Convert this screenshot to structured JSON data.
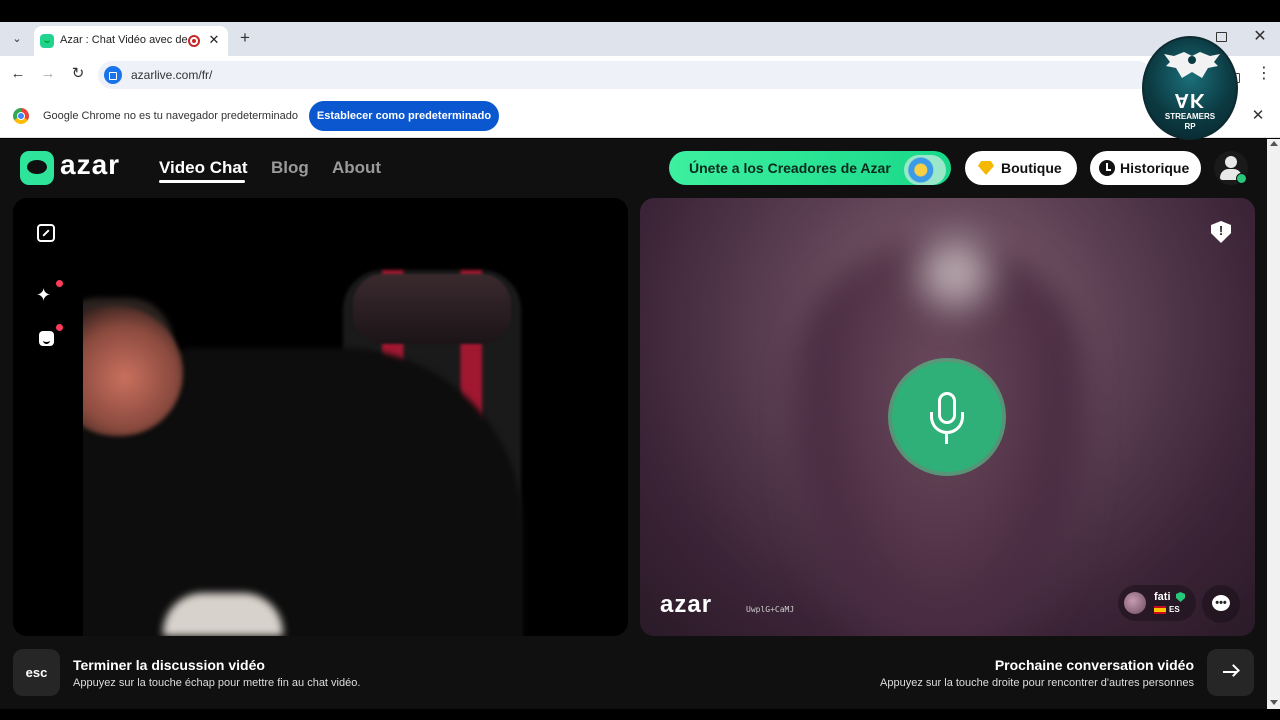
{
  "browser": {
    "tab_title": "Azar : Chat Vidéo avec de n",
    "tab_close": "✕",
    "new_tab": "+",
    "tab_list": "⌄",
    "window_close": "✕",
    "back": "←",
    "forward": "→",
    "reload": "↻",
    "url": "azarlive.com/fr/",
    "menu": "⋮"
  },
  "infobar": {
    "message": "Google Chrome no es tu navegador predeterminado",
    "button_label": "Establecer como predeterminado",
    "close": "✕"
  },
  "watermark": {
    "big": "AK",
    "line1": "STREAMERS",
    "line2": "RP"
  },
  "header": {
    "logo_text": "azar",
    "nav": [
      {
        "label": "Video Chat",
        "active": true
      },
      {
        "label": "Blog",
        "active": false
      },
      {
        "label": "About",
        "active": false
      }
    ],
    "creators_label": "Únete a los Creadores de Azar",
    "boutique_label": "Boutique",
    "history_label": "Historique"
  },
  "left_video": {
    "sparkle_glyph": "✦"
  },
  "right_video": {
    "watermark_text": "azar",
    "watermark_code": "UwplG+CaMJ",
    "user": {
      "name": "fati",
      "lang": "ES"
    },
    "chat_glyph": "•••"
  },
  "footer": {
    "esc_label": "esc",
    "end_title": "Terminer la discussion vidéo",
    "end_sub": "Appuyez sur la touche échap pour mettre fin au chat vidéo.",
    "next_title": "Prochaine conversation vidéo",
    "next_sub": "Appuyez sur la touche droite pour rencontrer d'autres personnes"
  },
  "colors": {
    "accent_green": "#2ee39a",
    "mic_green": "#2fb078",
    "chrome_blue": "#0b57d0",
    "notif_red": "#ff3b5c"
  }
}
